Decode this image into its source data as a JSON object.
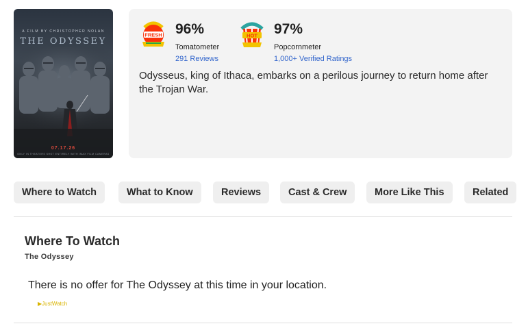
{
  "poster": {
    "credit": "A FILM BY CHRISTOPHER NOLAN",
    "title": "THE ODYSSEY",
    "date": "07.17.26",
    "tagline": "ONLY IN THEATERS  SHOT ENTIRELY WITH IMAX FILM CAMERAS"
  },
  "scores": {
    "tomatometer": {
      "icon": "certified-fresh-icon",
      "value": "96%",
      "label": "Tomatometer",
      "link": "291 Reviews",
      "color": "#fa320a"
    },
    "popcornmeter": {
      "icon": "verified-hot-icon",
      "value": "97%",
      "label": "Popcornmeter",
      "link": "1,000+ Verified Ratings",
      "color": "#fa320a"
    }
  },
  "synopsis": "Odysseus, king of Ithaca, embarks on a perilous journey to return home after the Trojan War.",
  "tabs": [
    {
      "label": "Where to Watch"
    },
    {
      "label": "What to Know"
    },
    {
      "label": "Reviews"
    },
    {
      "label": "Cast & Crew"
    },
    {
      "label": "More Like This"
    },
    {
      "label": "Related"
    }
  ],
  "where_to_watch": {
    "heading": "Where To Watch",
    "title": "The Odyssey",
    "message": "There is no offer for The Odyssey at this time in your location.",
    "provider": "JustWatch"
  }
}
